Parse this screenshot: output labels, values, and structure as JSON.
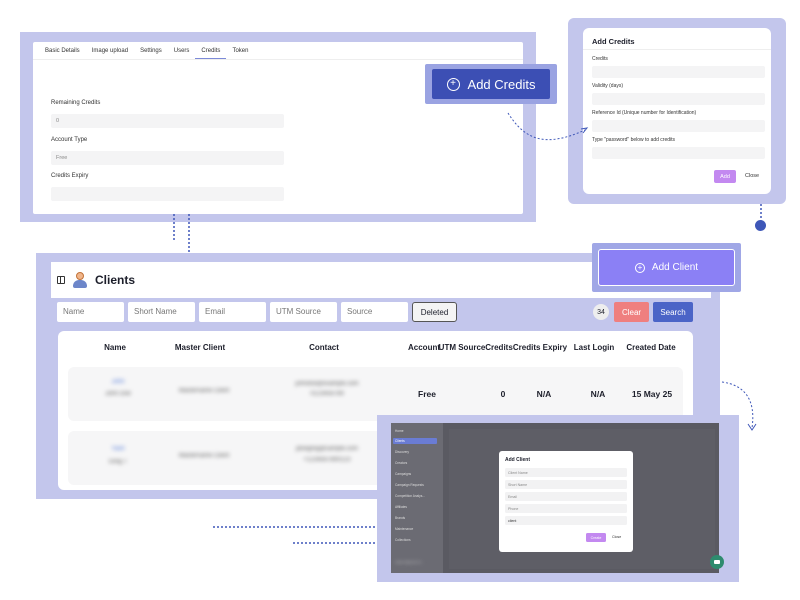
{
  "credits_panel": {
    "tabs": [
      "Basic Details",
      "Image upload",
      "Settings",
      "Users",
      "Credits",
      "Token"
    ],
    "active_tab": "Credits",
    "fields": [
      {
        "label": "Remaining Credits",
        "value": "0"
      },
      {
        "label": "Account Type",
        "value": "Free"
      },
      {
        "label": "Credits Expiry",
        "value": ""
      }
    ]
  },
  "add_credits_button": {
    "label": "Add Credits",
    "icon": "plus-circle-icon"
  },
  "add_credits_modal": {
    "title": "Add Credits",
    "fields": [
      {
        "label": "Credits"
      },
      {
        "label": "Validity (days)"
      },
      {
        "label": "Reference Id (Unique number for Identification)"
      },
      {
        "label": "Type \"password\" below to add credits"
      }
    ],
    "add_label": "Add",
    "close_label": "Close",
    "accent": "#c389f0"
  },
  "clients": {
    "title": "Clients",
    "filters": {
      "name_placeholder": "Name",
      "short_name_placeholder": "Short Name",
      "email_placeholder": "Email",
      "utm_source_placeholder": "UTM Source",
      "source_placeholder": "Source",
      "deleted_label": "Deleted",
      "count": "34",
      "clear_label": "Clear",
      "search_label": "Search"
    },
    "columns": [
      "Name",
      "Master Client",
      "Contact",
      "Account",
      "UTM Source",
      "Credits",
      "Credits Expiry",
      "Last Login",
      "Created Date"
    ],
    "rows": [
      {
        "name_line1": "John",
        "name_line2": "John Doe",
        "master_client": "Mastername Client",
        "contact_line1": "johndoe@example.com",
        "contact_line2": "0123456789",
        "account": "Free",
        "credits": "0",
        "credits_expiry": "N/A",
        "last_login": "N/A",
        "created_date": "15 May 25"
      },
      {
        "name_line1": "Yash",
        "name_line2": "Greg T",
        "master_client": "Mastername Client",
        "contact_line1": "jdoegreg@sample.com",
        "contact_line2": "+1234567890123",
        "account": "",
        "credits": "",
        "credits_expiry": "",
        "last_login": "",
        "created_date": ""
      }
    ]
  },
  "add_client_button": {
    "label": "Add Client",
    "icon": "plus-circle-icon",
    "color": "#8b80f5"
  },
  "dashboard_preview": {
    "nav": [
      "Home",
      "Clients",
      "Discovery",
      "Creators",
      "Campaigns",
      "Campaign Requests",
      "Competition Analys...",
      "Affiliates",
      "Brands",
      "Maintenance",
      "Collections"
    ],
    "active_nav": "Clients",
    "user_email": "dwaate.tt@gmail.com",
    "modal": {
      "title": "Add Client",
      "fields": [
        "Client Name",
        "Short Name",
        "Email",
        "Phone",
        "client"
      ],
      "create_label": "Create",
      "close_label": "Close"
    }
  }
}
